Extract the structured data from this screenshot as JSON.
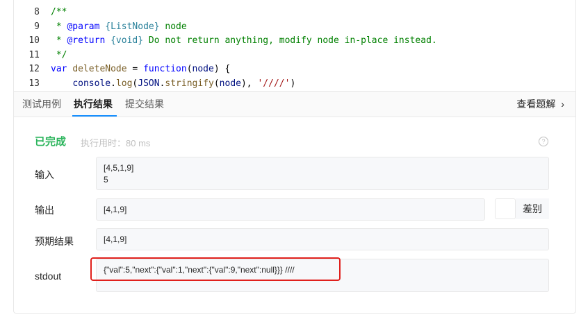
{
  "editor": {
    "lines": [
      {
        "num": "8",
        "tokens": [
          {
            "c": "c-cm",
            "t": "/**"
          }
        ]
      },
      {
        "num": "9",
        "tokens": [
          {
            "c": "c-cm",
            "t": " * "
          },
          {
            "c": "c-tag",
            "t": "@param"
          },
          {
            "c": "c-cm",
            "t": " "
          },
          {
            "c": "c-type",
            "t": "{ListNode}"
          },
          {
            "c": "c-cm",
            "t": " node"
          }
        ]
      },
      {
        "num": "10",
        "tokens": [
          {
            "c": "c-cm",
            "t": " * "
          },
          {
            "c": "c-tag",
            "t": "@return"
          },
          {
            "c": "c-cm",
            "t": " "
          },
          {
            "c": "c-type",
            "t": "{void}"
          },
          {
            "c": "c-cm",
            "t": " Do not return anything, modify node in-place instead."
          }
        ]
      },
      {
        "num": "11",
        "tokens": [
          {
            "c": "c-cm",
            "t": " */"
          }
        ]
      },
      {
        "num": "12",
        "tokens": [
          {
            "c": "c-kw",
            "t": "var"
          },
          {
            "c": "c-plain",
            "t": " "
          },
          {
            "c": "c-fn",
            "t": "deleteNode"
          },
          {
            "c": "c-plain",
            "t": " = "
          },
          {
            "c": "c-kw",
            "t": "function"
          },
          {
            "c": "c-plain",
            "t": "("
          },
          {
            "c": "c-var",
            "t": "node"
          },
          {
            "c": "c-plain",
            "t": ") {"
          }
        ]
      },
      {
        "num": "13",
        "tokens": [
          {
            "c": "c-plain",
            "t": "    "
          },
          {
            "c": "c-var",
            "t": "console"
          },
          {
            "c": "c-plain",
            "t": "."
          },
          {
            "c": "c-fn",
            "t": "log"
          },
          {
            "c": "c-plain",
            "t": "("
          },
          {
            "c": "c-var",
            "t": "JSON"
          },
          {
            "c": "c-plain",
            "t": "."
          },
          {
            "c": "c-fn",
            "t": "stringify"
          },
          {
            "c": "c-plain",
            "t": "("
          },
          {
            "c": "c-var",
            "t": "node"
          },
          {
            "c": "c-plain",
            "t": "), "
          },
          {
            "c": "c-str",
            "t": "'////'"
          },
          {
            "c": "c-plain",
            "t": ")"
          }
        ]
      }
    ]
  },
  "tabs": {
    "test_case": "测试用例",
    "run_result": "执行结果",
    "submit_result": "提交结果",
    "view_solution": "查看题解",
    "chevron": "›"
  },
  "result": {
    "status": "已完成",
    "runtime": "执行用时：80 ms",
    "help": "?",
    "input_label": "输入",
    "input_line1": "[4,5,1,9]",
    "input_line2": "5",
    "output_label": "输出",
    "output_value": "[4,1,9]",
    "diff_label": "差别",
    "expected_label": "预期结果",
    "expected_value": "[4,1,9]",
    "stdout_label": "stdout",
    "stdout_value": "{\"val\":5,\"next\":{\"val\":1,\"next\":{\"val\":9,\"next\":null}}} ////"
  },
  "colors": {
    "accent": "#1890ff",
    "success": "#2db55d",
    "highlight": "#e0201c"
  }
}
